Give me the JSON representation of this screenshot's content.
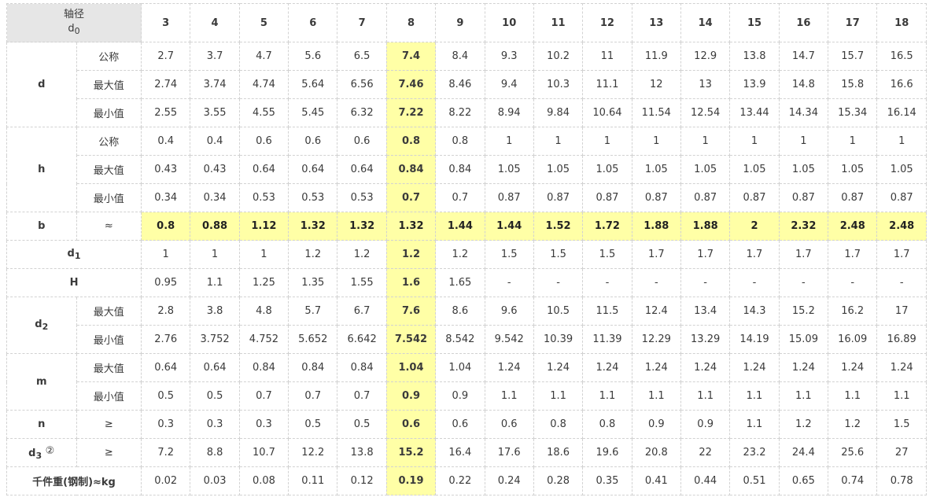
{
  "header": {
    "title_line1": "轴径",
    "title_base": "d",
    "title_sub": "0",
    "columns": [
      "3",
      "4",
      "5",
      "6",
      "7",
      "8",
      "9",
      "10",
      "11",
      "12",
      "13",
      "14",
      "15",
      "16",
      "17",
      "18"
    ]
  },
  "highlight_color": "#ffffa6",
  "header_color": "#1f5fa8",
  "rows": {
    "d": {
      "symbol": "d",
      "nominal_label": "公称",
      "nominal": [
        "2.7",
        "3.7",
        "4.7",
        "5.6",
        "6.5",
        "7.4",
        "8.4",
        "9.3",
        "10.2",
        "11",
        "11.9",
        "12.9",
        "13.8",
        "14.7",
        "15.7",
        "16.5"
      ],
      "max_label": "最大值",
      "max": [
        "2.74",
        "3.74",
        "4.74",
        "5.64",
        "6.56",
        "7.46",
        "8.46",
        "9.4",
        "10.3",
        "11.1",
        "12",
        "13",
        "13.9",
        "14.8",
        "15.8",
        "16.6"
      ],
      "min_label": "最小值",
      "min": [
        "2.55",
        "3.55",
        "4.55",
        "5.45",
        "6.32",
        "7.22",
        "8.22",
        "8.94",
        "9.84",
        "10.64",
        "11.54",
        "12.54",
        "13.44",
        "14.34",
        "15.34",
        "16.14"
      ]
    },
    "h": {
      "symbol": "h",
      "nominal_label": "公称",
      "nominal": [
        "0.4",
        "0.4",
        "0.6",
        "0.6",
        "0.6",
        "0.8",
        "0.8",
        "1",
        "1",
        "1",
        "1",
        "1",
        "1",
        "1",
        "1",
        "1"
      ],
      "max_label": "最大值",
      "max": [
        "0.43",
        "0.43",
        "0.64",
        "0.64",
        "0.64",
        "0.84",
        "0.84",
        "1.05",
        "1.05",
        "1.05",
        "1.05",
        "1.05",
        "1.05",
        "1.05",
        "1.05",
        "1.05"
      ],
      "min_label": "最小值",
      "min": [
        "0.34",
        "0.34",
        "0.53",
        "0.53",
        "0.53",
        "0.7",
        "0.7",
        "0.87",
        "0.87",
        "0.87",
        "0.87",
        "0.87",
        "0.87",
        "0.87",
        "0.87",
        "0.87"
      ]
    },
    "b": {
      "symbol": "b",
      "qualifier": "≈",
      "values": [
        "0.8",
        "0.88",
        "1.12",
        "1.32",
        "1.32",
        "1.32",
        "1.44",
        "1.44",
        "1.52",
        "1.72",
        "1.88",
        "1.88",
        "2",
        "2.32",
        "2.48",
        "2.48"
      ]
    },
    "d1": {
      "symbol_base": "d",
      "symbol_sub": "1",
      "values": [
        "1",
        "1",
        "1",
        "1.2",
        "1.2",
        "1.2",
        "1.2",
        "1.5",
        "1.5",
        "1.5",
        "1.7",
        "1.7",
        "1.7",
        "1.7",
        "1.7",
        "1.7"
      ]
    },
    "H": {
      "symbol": "H",
      "values": [
        "0.95",
        "1.1",
        "1.25",
        "1.35",
        "1.55",
        "1.6",
        "1.65",
        "-",
        "-",
        "-",
        "-",
        "-",
        "-",
        "-",
        "-",
        "-"
      ]
    },
    "d2": {
      "symbol_base": "d",
      "symbol_sub": "2",
      "max_label": "最大值",
      "max": [
        "2.8",
        "3.8",
        "4.8",
        "5.7",
        "6.7",
        "7.6",
        "8.6",
        "9.6",
        "10.5",
        "11.5",
        "12.4",
        "13.4",
        "14.3",
        "15.2",
        "16.2",
        "17"
      ],
      "min_label": "最小值",
      "min": [
        "2.76",
        "3.752",
        "4.752",
        "5.652",
        "6.642",
        "7.542",
        "8.542",
        "9.542",
        "10.39",
        "11.39",
        "12.29",
        "13.29",
        "14.19",
        "15.09",
        "16.09",
        "16.89"
      ]
    },
    "m": {
      "symbol": "m",
      "max_label": "最大值",
      "max": [
        "0.64",
        "0.64",
        "0.84",
        "0.84",
        "0.84",
        "1.04",
        "1.04",
        "1.24",
        "1.24",
        "1.24",
        "1.24",
        "1.24",
        "1.24",
        "1.24",
        "1.24",
        "1.24"
      ],
      "min_label": "最小值",
      "min": [
        "0.5",
        "0.5",
        "0.7",
        "0.7",
        "0.7",
        "0.9",
        "0.9",
        "1.1",
        "1.1",
        "1.1",
        "1.1",
        "1.1",
        "1.1",
        "1.1",
        "1.1",
        "1.1"
      ]
    },
    "n": {
      "symbol": "n",
      "qualifier": "≥",
      "values": [
        "0.3",
        "0.3",
        "0.3",
        "0.5",
        "0.5",
        "0.6",
        "0.6",
        "0.6",
        "0.8",
        "0.8",
        "0.9",
        "0.9",
        "1.1",
        "1.2",
        "1.2",
        "1.5"
      ]
    },
    "d3": {
      "symbol_base": "d",
      "symbol_sub": "3",
      "note": "②",
      "qualifier": "≥",
      "values": [
        "7.2",
        "8.8",
        "10.7",
        "12.2",
        "13.8",
        "15.2",
        "16.4",
        "17.6",
        "18.6",
        "19.6",
        "20.8",
        "22",
        "23.2",
        "24.4",
        "25.6",
        "27"
      ]
    },
    "weight": {
      "label": "千件重(钢制)≈kg",
      "values": [
        "0.02",
        "0.03",
        "0.08",
        "0.11",
        "0.12",
        "0.19",
        "0.22",
        "0.24",
        "0.28",
        "0.35",
        "0.41",
        "0.44",
        "0.51",
        "0.65",
        "0.74",
        "0.78"
      ]
    }
  }
}
